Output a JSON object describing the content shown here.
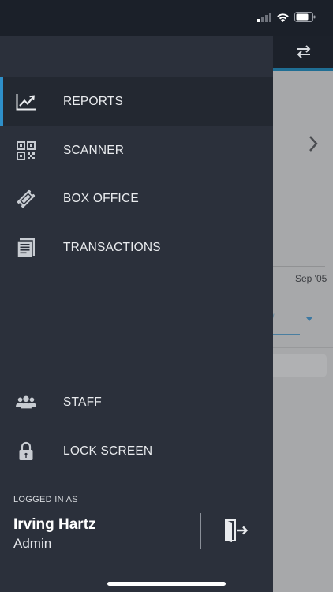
{
  "nav": {
    "items": [
      {
        "label": "REPORTS",
        "icon": "chart-line-icon",
        "active": true
      },
      {
        "label": "SCANNER",
        "icon": "qr-code-icon"
      },
      {
        "label": "BOX OFFICE",
        "icon": "ticket-icon"
      },
      {
        "label": "TRANSACTIONS",
        "icon": "receipt-icon"
      }
    ],
    "bottom_items": [
      {
        "label": "STAFF",
        "icon": "people-icon"
      },
      {
        "label": "LOCK SCREEN",
        "icon": "lock-icon"
      }
    ]
  },
  "user": {
    "logged_in_label": "LOGGED IN AS",
    "name": "Irving Hartz",
    "role": "Admin"
  },
  "background": {
    "date_label": "Sep '05",
    "dropdown_fragment": "/"
  },
  "colors": {
    "drawer_bg": "#2b303b",
    "active_bg": "#232831",
    "accent": "#2e8fc9",
    "status_bar_bg": "#1b2029"
  }
}
